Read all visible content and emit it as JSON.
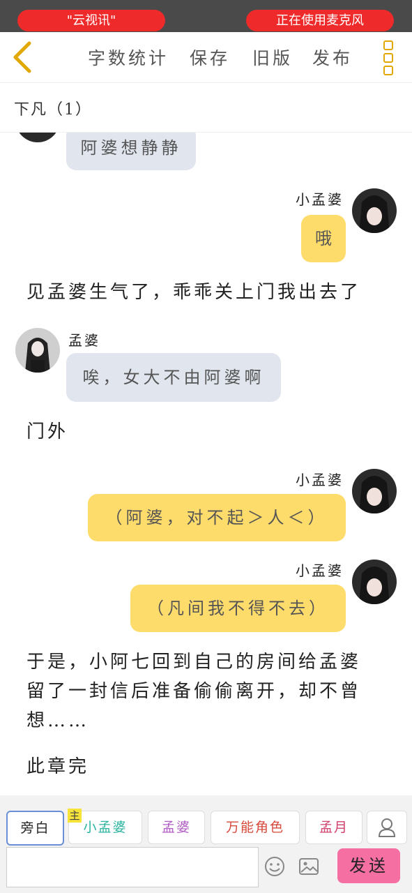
{
  "status": {
    "left_pill": "\"云视讯\"",
    "right_pill": "正在使用麦克风"
  },
  "toolbar": {
    "word_count": "字数统计",
    "save": "保存",
    "old_version": "旧版",
    "publish": "发布"
  },
  "chapter": {
    "title": "下凡（1）"
  },
  "messages": [
    {
      "type": "left",
      "speaker": "",
      "text": "阿婆想静静"
    },
    {
      "type": "right",
      "speaker": "小孟婆",
      "text": "哦"
    },
    {
      "type": "narration",
      "text": "见孟婆生气了，乖乖关上门我出去了"
    },
    {
      "type": "left",
      "speaker": "孟婆",
      "text": "唉，女大不由阿婆啊"
    },
    {
      "type": "narration",
      "text": "门外"
    },
    {
      "type": "right",
      "speaker": "小孟婆",
      "text": "（阿婆，对不起＞人＜）"
    },
    {
      "type": "right",
      "speaker": "小孟婆",
      "text": "（凡间我不得不去）"
    },
    {
      "type": "narration",
      "text": "于是，小阿七回到自己的房间给孟婆留了一封信后准备偷偷离开，却不曾想……"
    },
    {
      "type": "narration",
      "text": "此章完"
    }
  ],
  "roles": [
    {
      "label": "旁白",
      "color": "#333333"
    },
    {
      "label": "小孟婆",
      "color": "#2bb3a0",
      "badge": "主"
    },
    {
      "label": "孟婆",
      "color": "#b05cc4"
    },
    {
      "label": "万能角色",
      "color": "#d6493b"
    },
    {
      "label": "孟月",
      "color": "#d0406a"
    }
  ],
  "composer": {
    "send_label": "发送",
    "input_value": ""
  },
  "colors": {
    "bubble_left": "#e0e5ee",
    "bubble_right": "#fedc6c",
    "send": "#f56fa3",
    "accent": "#e0a800"
  }
}
